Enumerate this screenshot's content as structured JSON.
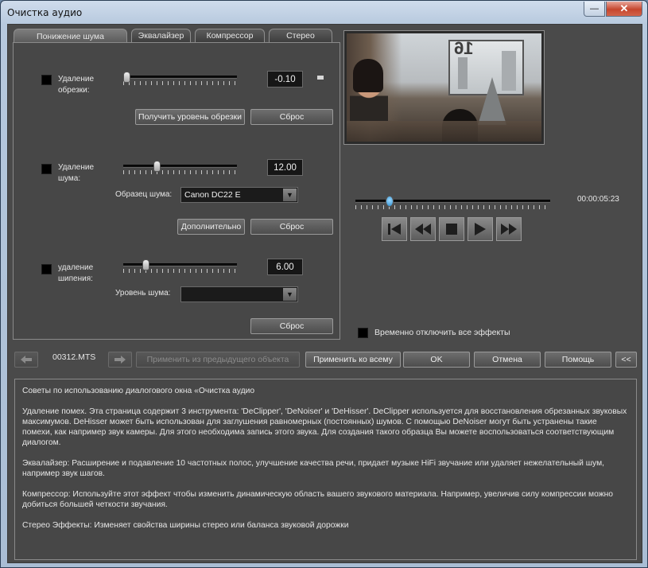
{
  "window": {
    "title": "Очистка аудио",
    "minimize_glyph": "—",
    "close_glyph": "✕"
  },
  "tabs": [
    {
      "label": "Понижение шума",
      "active": true
    },
    {
      "label": "Эквалайзер",
      "active": false
    },
    {
      "label": "Компрессор",
      "active": false
    },
    {
      "label": "Стерео",
      "active": false
    }
  ],
  "declipper": {
    "label": "Удаление обрезки:",
    "value": "-0.10",
    "slider_fraction": 0.0,
    "get_level_button": "Получить уровень обрезки",
    "reset_button": "Сброс"
  },
  "denoiser": {
    "label": "Удаление шума:",
    "value": "12.00",
    "slider_fraction": 0.28,
    "sample_label": "Образец шума:",
    "sample_value": "Canon DC22 E",
    "advanced_button": "Дополнительно",
    "reset_button": "Сброс"
  },
  "dehisser": {
    "label": "удаление шипения:",
    "value": "6.00",
    "slider_fraction": 0.18,
    "level_label": "Уровень шума:",
    "level_value": "",
    "reset_button": "Сброс"
  },
  "player": {
    "timecode": "00:00:05:23",
    "position_fraction": 0.16,
    "buttons": [
      "go-to-start-icon",
      "rewind-icon",
      "stop-icon",
      "play-icon",
      "fast-forward-icon"
    ]
  },
  "bypass_label": "Временно отключить все эффекты",
  "nav": {
    "filename": "00312.MTS",
    "apply_prev": "Применить из предыдущего объекта",
    "apply_all": "Применить ко всему",
    "ok": "OK",
    "cancel": "Отмена",
    "help": "Помощь",
    "collapse": "<<"
  },
  "tips": [
    "Советы по использованию диалогового окна «Очистка аудио",
    "Удаление помех. Эта страница содержит 3 инструмента: 'DeClipper', 'DeNoiser' и 'DeHisser'. DeClipper используется для восстановления обрезанных звуковых максимумов. DeHisser может быть использован для заглушения равномерных (постоянных) шумов. С помощью DeNoiser могут быть устранены такие помехи, как например звук камеры. Для этого необходима запись этого звука. Для создания такого образца Вы можете воспользоваться соответствующим диалогом.",
    "Эквалайзер: Расширение и подавление 10 частотных полос, улучшение качества речи, придает музыке HiFi звучание или удаляет нежелательный шум, например звук шагов.",
    "Компрессор: Используйте этот эффект чтобы изменить динамическую область вашего звукового материала. Например, увеличив силу компрессии можно добиться большей четкости звучания.",
    "Стерео Эффекты: Изменяет свойства ширины стерео или баланса звуковой дорожки"
  ],
  "video_overlay": "16"
}
